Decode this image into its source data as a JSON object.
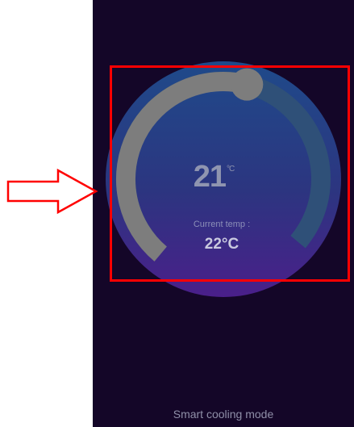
{
  "thermostat": {
    "set_temperature": "21",
    "set_unit": "°C",
    "current_label": "Current temp :",
    "current_value": "22°C",
    "arc_level": 0.55
  },
  "footer": {
    "mode_label": "Smart cooling mode"
  },
  "colors": {
    "background": "#140628",
    "dial_top": "#1f4a8a",
    "dial_bottom": "#4a1f8a",
    "arc_track": "#2f5078",
    "arc_fill": "#7d7d7d",
    "annotation": "#ff0000"
  },
  "icons": {
    "pointer_arrow": "right-outline-arrow-icon"
  }
}
